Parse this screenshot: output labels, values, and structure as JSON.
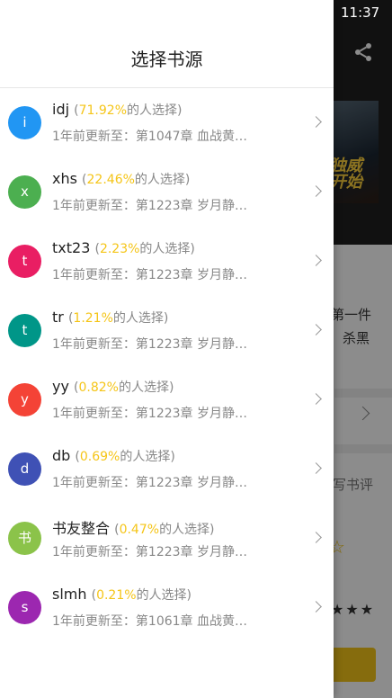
{
  "status_bar": {
    "time": "11:37"
  },
  "background": {
    "cover_text": "独威\n开始",
    "snippet_1": "第一件",
    "snippet_2": "杀黑",
    "write_review": "写书评"
  },
  "drawer": {
    "title": "选择书源",
    "sources": [
      {
        "avatar": "i",
        "color": "#2196f3",
        "name": "idj",
        "percent": "71.92%",
        "suffix": "的人选择)",
        "update": "1年前更新至：第1047章 血战黄…"
      },
      {
        "avatar": "x",
        "color": "#4caf50",
        "name": "xhs",
        "percent": "22.46%",
        "suffix": "的人选择)",
        "update": "1年前更新至：第1223章 岁月静…"
      },
      {
        "avatar": "t",
        "color": "#e91e63",
        "name": "txt23",
        "percent": "2.23%",
        "suffix": "的人选择)",
        "update": "1年前更新至：第1223章 岁月静…"
      },
      {
        "avatar": "t",
        "color": "#009688",
        "name": "tr",
        "percent": "1.21%",
        "suffix": "的人选择)",
        "update": "1年前更新至：第1223章 岁月静…"
      },
      {
        "avatar": "y",
        "color": "#f44336",
        "name": "yy",
        "percent": "0.82%",
        "suffix": "的人选择)",
        "update": "1年前更新至：第1223章 岁月静…"
      },
      {
        "avatar": "d",
        "color": "#3f51b5",
        "name": "db",
        "percent": "0.69%",
        "suffix": "的人选择)",
        "update": "1年前更新至：第1223章 岁月静…"
      },
      {
        "avatar": "书",
        "color": "#8bc34a",
        "name": "书友整合",
        "percent": "0.47%",
        "suffix": "的人选择)",
        "update": "1年前更新至：第1223章 岁月静…"
      },
      {
        "avatar": "s",
        "color": "#9c27b0",
        "name": "slmh",
        "percent": "0.21%",
        "suffix": "的人选择)",
        "update": "1年前更新至：第1061章 血战黄…"
      }
    ]
  }
}
